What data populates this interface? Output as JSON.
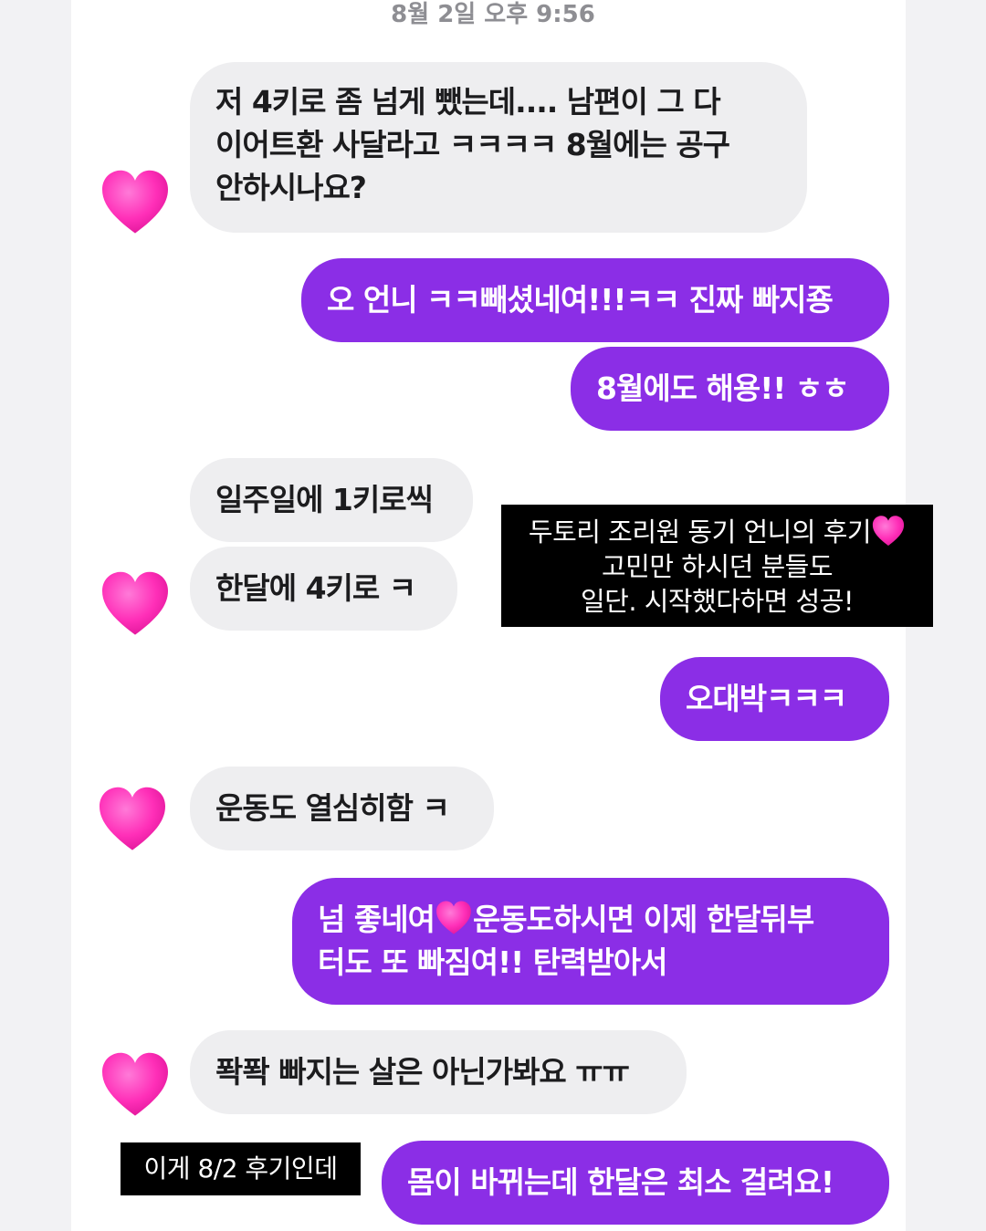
{
  "timestamp": "8월 2일 오후 9:56",
  "colors": {
    "outgoing": "#8b2ee6",
    "incoming": "#eeeef0",
    "heart": "#ff3fc0"
  },
  "avatar_icon": "pink-heart",
  "messages": [
    {
      "from": "other",
      "lines": [
        "저 4키로 좀 넘게 뺐는데.... 남편이 그 다",
        "이어트환 사달라고 ㅋㅋㅋㅋ 8월에는 공구",
        "안하시나요?"
      ]
    },
    {
      "from": "me",
      "text": "오 언니 ㅋㅋ빼셨네여!!!ㅋㅋ 진짜 빠지죵"
    },
    {
      "from": "me",
      "text": "8월에도 해용!! ㅎㅎ"
    },
    {
      "from": "other",
      "text": "일주일에 1키로씩"
    },
    {
      "from": "other",
      "text": "한달에 4키로 ㅋ"
    },
    {
      "from": "me",
      "text": "오대박ㅋㅋㅋ"
    },
    {
      "from": "other",
      "text": "운동도 열심히함 ㅋ"
    },
    {
      "from": "me",
      "line1_a": "넘 좋네여",
      "line1_b": "운동도하시면 이제 한달뒤부",
      "line2": "터도 또 빠짐여!! 탄력받아서"
    },
    {
      "from": "other",
      "text": "퐉퐉 빠지는 살은 아닌가봐요 ㅠㅠ"
    },
    {
      "from": "me",
      "text": "몸이 바뀌는데 한달은 최소 걸려요!"
    }
  ],
  "caption_review": {
    "line1": "두토리 조리원 동기 언니의 후기",
    "line2": "고민만 하시던 분들도",
    "line3": "일단. 시작했다하면 성공!"
  },
  "caption_date": "이게 8/2 후기인데"
}
